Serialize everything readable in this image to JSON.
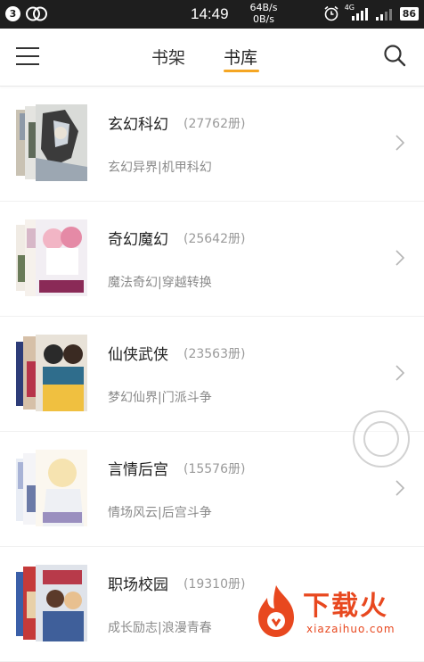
{
  "status_bar": {
    "badge": "3",
    "time": "14:49",
    "speed_up": "64B/s",
    "speed_down": "0B/s",
    "network": "4G",
    "battery": "86"
  },
  "header": {
    "tabs": [
      {
        "label": "书架",
        "active": false
      },
      {
        "label": "书库",
        "active": true
      }
    ],
    "accent_color": "#f5a623"
  },
  "categories": [
    {
      "title": "玄幻科幻",
      "count": "(27762册)",
      "tags": "玄幻异界|机甲科幻"
    },
    {
      "title": "奇幻魔幻",
      "count": "(25642册)",
      "tags": "魔法奇幻|穿越转换"
    },
    {
      "title": "仙侠武侠",
      "count": "(23563册)",
      "tags": "梦幻仙界|门派斗争"
    },
    {
      "title": "言情后宫",
      "count": "(15576册)",
      "tags": "情场风云|后宫斗争"
    },
    {
      "title": "职场校园",
      "count": "(19310册)",
      "tags": "成长励志|浪漫青春"
    }
  ],
  "watermark": {
    "text": "下载火",
    "domain": "xiazaihuo.com"
  }
}
